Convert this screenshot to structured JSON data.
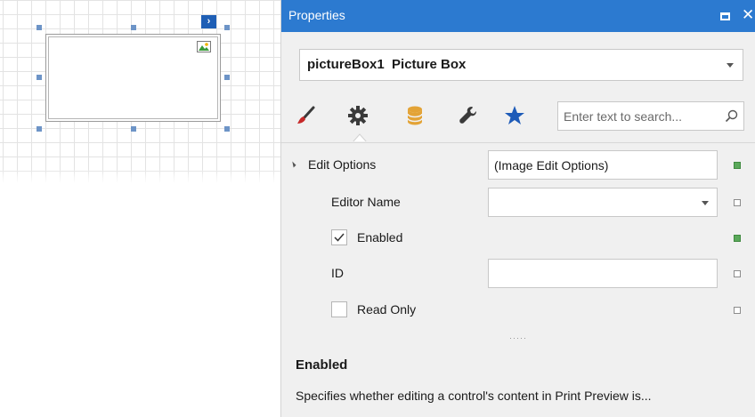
{
  "panel": {
    "title": "Properties",
    "selected_object": "pictureBox1  Picture Box",
    "search_placeholder": "Enter text to search...",
    "tabs": [
      {
        "name": "appearance",
        "icon": "brush-icon"
      },
      {
        "name": "behavior",
        "icon": "gear-icon",
        "selected": true
      },
      {
        "name": "data",
        "icon": "database-icon"
      },
      {
        "name": "tools",
        "icon": "wrench-icon"
      },
      {
        "name": "favorites",
        "icon": "star-icon"
      }
    ]
  },
  "grid": {
    "edit_options": {
      "label": "Edit Options",
      "value": "(Image Edit Options)"
    },
    "editor_name": {
      "label": "Editor Name",
      "value": ""
    },
    "enabled": {
      "label": "Enabled",
      "checked": true
    },
    "id": {
      "label": "ID",
      "value": ""
    },
    "read_only": {
      "label": "Read Only",
      "checked": false
    }
  },
  "description": {
    "title": "Enabled",
    "text": "Specifies whether editing a control's content in Print Preview is..."
  },
  "colors": {
    "titlebar": "#2c7ad0",
    "modified_marker": "#5aa85a",
    "star": "#1e5bb8",
    "database": "#e3a336",
    "brush_tip": "#c62828"
  }
}
